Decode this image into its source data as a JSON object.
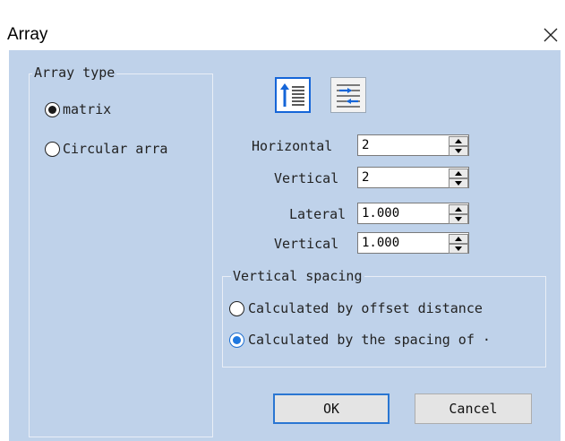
{
  "window": {
    "title": "Array"
  },
  "array_type": {
    "legend": "Array type",
    "options": [
      {
        "label": "matrix",
        "selected": true
      },
      {
        "label": "Circular arra",
        "selected": false
      }
    ]
  },
  "mode_icons": [
    "vertical-order-icon",
    "horizontal-order-icon"
  ],
  "count": {
    "horizontal_label": "Horizontal",
    "horizontal_value": "2",
    "vertical_label": "Vertical",
    "vertical_value": "2"
  },
  "spacing": {
    "lateral_label": "Lateral",
    "lateral_value": "1.000",
    "vertical_label": "Vertical",
    "vertical_value": "1.000"
  },
  "vertical_spacing": {
    "legend": "Vertical spacing",
    "options": [
      {
        "label": "Calculated by offset distance",
        "selected": false
      },
      {
        "label": "Calculated by the spacing of ·",
        "selected": true
      }
    ]
  },
  "buttons": {
    "ok": "OK",
    "cancel": "Cancel"
  },
  "colors": {
    "client_bg": "#bfd2ea",
    "accent": "#1f78e0",
    "icon_blue": "#1565d8"
  }
}
